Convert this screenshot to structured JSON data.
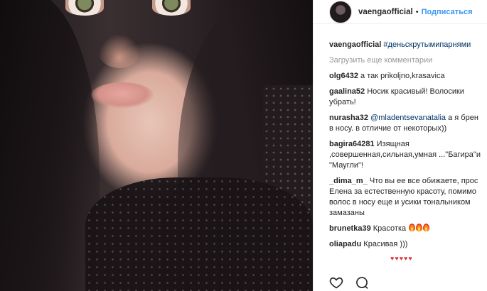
{
  "header": {
    "username": "vaengaofficial",
    "separator": "•",
    "follow_label": "Подписаться"
  },
  "caption": {
    "username": "vaengaofficial",
    "text": "#деньскрутымипарнями"
  },
  "load_more_label": "Загрузить еще комментарии",
  "comments": [
    {
      "user": "olg6432",
      "text": "а так prikoljno,krasavica"
    },
    {
      "user": "gaalina52",
      "text": "Носик красивый! Волосики",
      "text2": "убрать!"
    },
    {
      "user": "nurasha32",
      "mention": "@mladentsevanatalia",
      "text": "а я брен",
      "text2": "в носу. в отличие от некоторых))"
    },
    {
      "user": "bagira64281",
      "text": "Изящная",
      "text2": ",совершенная,сильная,умная ...\"Багира\"и",
      "text3": "\"Маугли\"!"
    },
    {
      "user": "_dima_m_",
      "text": "Что вы ее все обижаете, прос",
      "text2": "Елена за естественную красоту, помимо",
      "text3": "волос в носу еще и усики тональником",
      "text4": "замазаны"
    },
    {
      "user": "brunetka39",
      "text": "Красотка"
    },
    {
      "user": "oliapadu",
      "text": "Красивая )))"
    }
  ],
  "icons": {
    "like": "heart-icon",
    "comment": "comment-icon"
  },
  "colors": {
    "accent": "#3897f0",
    "mention": "#003569",
    "muted": "#999999"
  }
}
